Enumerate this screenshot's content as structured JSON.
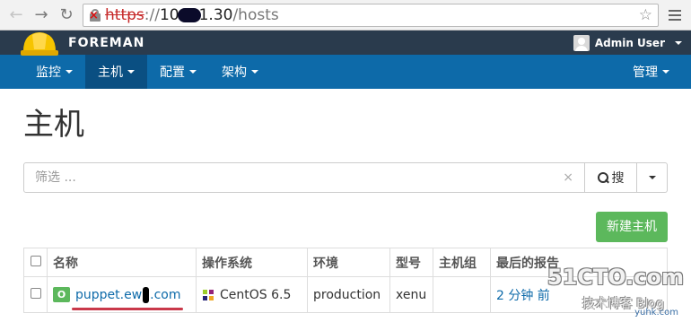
{
  "browser": {
    "back_icon": "back-arrow-icon",
    "forward_icon": "forward-arrow-icon",
    "reload_icon": "reload-icon",
    "url_scheme": "https",
    "url_sep": "://",
    "url_host_start": "10",
    "url_host_end": "1.30",
    "url_path": "/hosts",
    "star_icon": "star-icon",
    "menu_icon": "hamburger-menu-icon"
  },
  "brand": {
    "name": "FOREMAN",
    "logo_icon": "hardhat-logo-icon",
    "user": "Admin User"
  },
  "nav": {
    "items": [
      {
        "label": "监控"
      },
      {
        "label": "主机"
      },
      {
        "label": "配置"
      },
      {
        "label": "架构"
      }
    ],
    "admin": "管理"
  },
  "page": {
    "title": "主机"
  },
  "search": {
    "placeholder": "筛选 ...",
    "button_label": "搜"
  },
  "actions": {
    "new_host": "新建主机"
  },
  "table": {
    "headers": [
      "名称",
      "操作系统",
      "环境",
      "型号",
      "主机组",
      "最后的报告"
    ],
    "rows": [
      {
        "status": "O",
        "name_start": "puppet.ew",
        "name_end": ".com",
        "os": "CentOS 6.5",
        "environment": "production",
        "model": "xenu",
        "hostgroup": "",
        "last_report": "2 分钟 前"
      }
    ]
  },
  "watermark": {
    "line1": "51CTO.com",
    "line2": "技术博客",
    "line3": "Blog",
    "line4": "yuhk.com"
  },
  "colors": {
    "topbar": "#2a3b4d",
    "navbar": "#0d6aa9",
    "nav_active": "#0a4f82",
    "success": "#5cb85c",
    "link": "#0d6aa9"
  }
}
